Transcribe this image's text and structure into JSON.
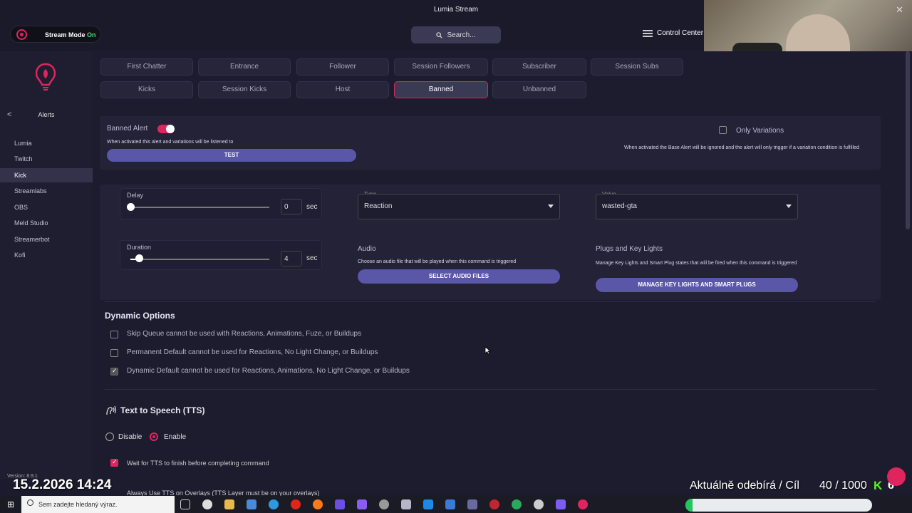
{
  "window": {
    "title": "Lumia Stream",
    "close_glyph": "✕"
  },
  "header": {
    "stream_mode_label": "Stream Mode",
    "stream_mode_state": "On",
    "search_placeholder": "Search...",
    "control_center_label": "Control Center"
  },
  "sidebar": {
    "back_glyph": "<",
    "title": "Alerts",
    "items": [
      {
        "label": "Lumia"
      },
      {
        "label": "Twitch"
      },
      {
        "label": "Kick"
      },
      {
        "label": "Streamlabs"
      },
      {
        "label": "OBS"
      },
      {
        "label": "Meld Studio"
      },
      {
        "label": "Streamerbot"
      },
      {
        "label": "Kofi"
      }
    ],
    "active_item": "Kick",
    "version": "Version: 8.9.1"
  },
  "tabs": {
    "row1": [
      "First Chatter",
      "Entrance",
      "Follower",
      "Session Followers",
      "Subscriber",
      "Session Subs"
    ],
    "row2": [
      "Kicks",
      "Session Kicks",
      "Host",
      "Banned",
      "Unbanned"
    ],
    "active": "Banned"
  },
  "alert": {
    "name_label": "Banned Alert",
    "enabled": true,
    "description": "When activated this alert and variations will be listened to",
    "test_button": "TEST",
    "only_variations_label": "Only Variations",
    "only_variations_description": "When activated the Base Alert will be ignored and the alert will only trigger if a variation condition is fulfilled"
  },
  "delay": {
    "label": "Delay",
    "value": "0",
    "unit": "sec",
    "slider_level": 0
  },
  "duration": {
    "label": "Duration",
    "value": "4",
    "unit": "sec",
    "slider_level": 0.07
  },
  "type_field": {
    "label": "Type",
    "value": "Reaction"
  },
  "value_field": {
    "label": "Value",
    "value": "wasted-gta"
  },
  "audio": {
    "label": "Audio",
    "description": "Choose an audio file that will be played when this command is triggered",
    "button": "SELECT AUDIO FILES"
  },
  "plugs": {
    "label": "Plugs and Key Lights",
    "description": "Manage Key Lights and Smart Plug states that will be fired when this command is triggered",
    "button": "MANAGE KEY LIGHTS AND SMART PLUGS"
  },
  "dynamic_options": {
    "title": "Dynamic Options",
    "items": [
      {
        "label": "Skip Queue cannot be used with Reactions, Animations, Fuze, or Buildups",
        "checked": false
      },
      {
        "label": "Permanent Default cannot be used for Reactions, No Light Change, or Buildups",
        "checked": false
      },
      {
        "label": "Dynamic Default cannot be used for Reactions, Animations, No Light Change, or Buildups",
        "checked": true
      }
    ]
  },
  "tts": {
    "title": "Text to Speech (TTS)",
    "disable_label": "Disable",
    "enable_label": "Enable",
    "selected": "Enable",
    "wait_label": "Wait for TTS to finish before completing command",
    "wait_checked": true,
    "overlay_label": "Always Use TTS on Overlays (TTS Layer must be on your overlays)"
  },
  "overlay": {
    "datetime": "15.2.2026 14:24",
    "subs_label": "Aktuálně odebírá / Cíl",
    "subs_count": "40 / 1000",
    "kick_glyph": "K",
    "kick_number": "6",
    "progress_fraction": 0.04
  },
  "taskbar": {
    "search_placeholder": "Sem zadejte hledaný výraz."
  },
  "colors": {
    "accent": "#e0245e",
    "button": "#5a56a8",
    "kick_green": "#53fc18"
  }
}
